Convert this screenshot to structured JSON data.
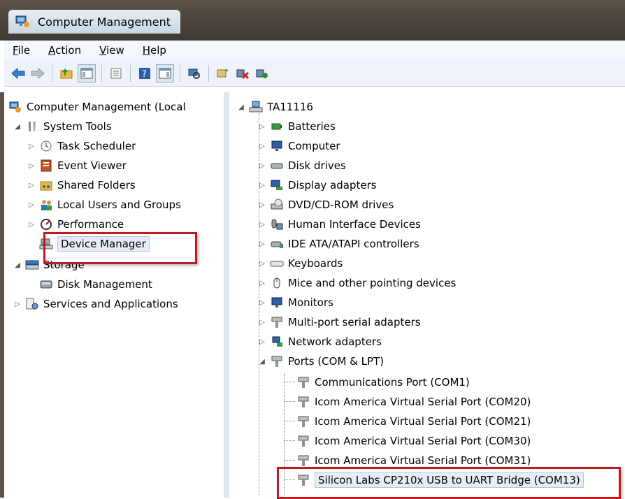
{
  "window": {
    "title": "Computer Management"
  },
  "menu": [
    {
      "label": "File",
      "key": "F",
      "rest": "ile"
    },
    {
      "label": "Action",
      "key": "A",
      "rest": "ction"
    },
    {
      "label": "View",
      "key": "V",
      "rest": "iew"
    },
    {
      "label": "Help",
      "key": "H",
      "rest": "elp"
    }
  ],
  "toolbar_icons": [
    "back-arrow-icon",
    "forward-arrow-icon",
    "up-folder-icon",
    "show-hide-console-tree-icon",
    "properties-icon",
    "help-icon",
    "show-hide-action-pane-icon",
    "scan-hardware-icon",
    "update-driver-icon",
    "uninstall-icon",
    "enable-device-icon"
  ],
  "left_tree": {
    "root": "Computer Management (Local",
    "system_tools": "System Tools",
    "task_scheduler": "Task Scheduler",
    "event_viewer": "Event Viewer",
    "shared_folders": "Shared Folders",
    "local_users": "Local Users and Groups",
    "performance": "Performance",
    "device_manager": "Device Manager",
    "storage": "Storage",
    "disk_management": "Disk Management",
    "services": "Services and Applications"
  },
  "right_tree": {
    "computer": "TA11116",
    "categories": [
      "Batteries",
      "Computer",
      "Disk drives",
      "Display adapters",
      "DVD/CD-ROM drives",
      "Human Interface Devices",
      "IDE ATA/ATAPI controllers",
      "Keyboards",
      "Mice and other pointing devices",
      "Monitors",
      "Multi-port serial adapters",
      "Network adapters",
      "Ports (COM & LPT)"
    ],
    "ports": [
      "Communications Port (COM1)",
      "Icom America Virtual Serial Port  (COM20)",
      "Icom America Virtual Serial Port  (COM21)",
      "Icom America Virtual Serial Port  (COM30)",
      "Icom America Virtual Serial Port  (COM31)",
      "Silicon Labs CP210x USB to UART Bridge (COM13)"
    ]
  },
  "colors": {
    "highlight": "#c0181f",
    "titlebar": "#4a443c"
  }
}
